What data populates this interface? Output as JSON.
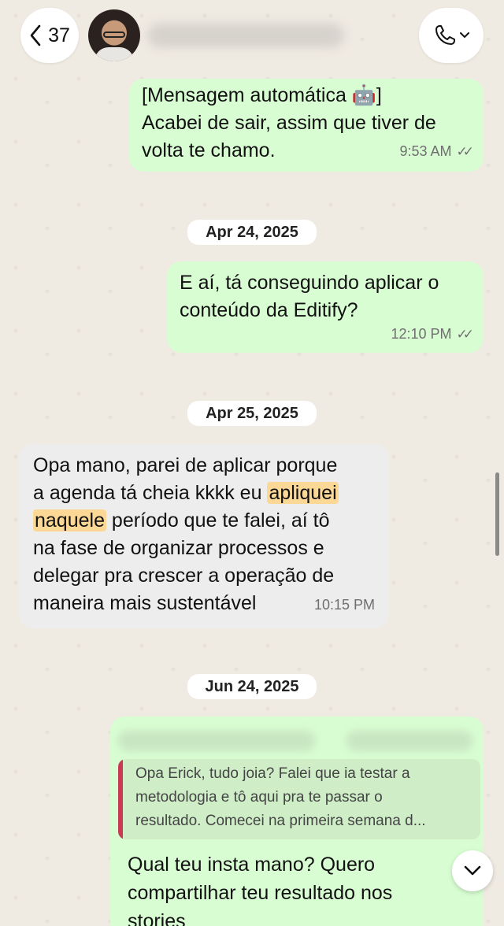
{
  "header": {
    "back_count": "37",
    "icons": {
      "back": "chevron-left-icon",
      "call": "phone-icon",
      "call_menu": "chevron-down-icon"
    }
  },
  "messages": [
    {
      "direction": "outgoing",
      "lines": [
        "[Mensagem automática 🤖]",
        "Acabei de sair, assim que tiver de",
        "volta te chamo."
      ],
      "time": "9:53 AM",
      "status": "read"
    },
    {
      "date_separator": "Apr 24, 2025"
    },
    {
      "direction": "outgoing",
      "lines": [
        "E aí, tá conseguindo aplicar o",
        "conteúdo da Editify?"
      ],
      "time": "12:10 PM",
      "status": "read"
    },
    {
      "date_separator": "Apr 25, 2025"
    },
    {
      "direction": "incoming",
      "line1": "Opa mano, parei de aplicar porque",
      "line2_pre": "a agenda tá cheia kkkk eu ",
      "line2_hl": "apliquei",
      "line3_hl": "naquele",
      "line3_post": " período que te falei, aí tô",
      "line4": "na fase de organizar processos e",
      "line5": "delegar pra crescer a operação de",
      "line6": "maneira mais sustentável",
      "time": "10:15 PM"
    },
    {
      "date_separator": "Jun 24, 2025"
    },
    {
      "direction": "outgoing",
      "quote_lines": [
        "Opa Erick, tudo joia? Falei que ia testar a",
        "metodologia e tô aqui pra te passar o",
        "resultado. Comecei na primeira semana d..."
      ],
      "lines": [
        "Qual teu insta mano? Quero",
        "compartilhar teu resultado nos",
        "stories"
      ]
    }
  ],
  "colors": {
    "outgoing_bubble": "#d9fdd3",
    "incoming_bubble": "#ededed",
    "highlight": "#fcd897",
    "quote_bar": "#c93a55",
    "wallpaper": "#efeae2"
  }
}
